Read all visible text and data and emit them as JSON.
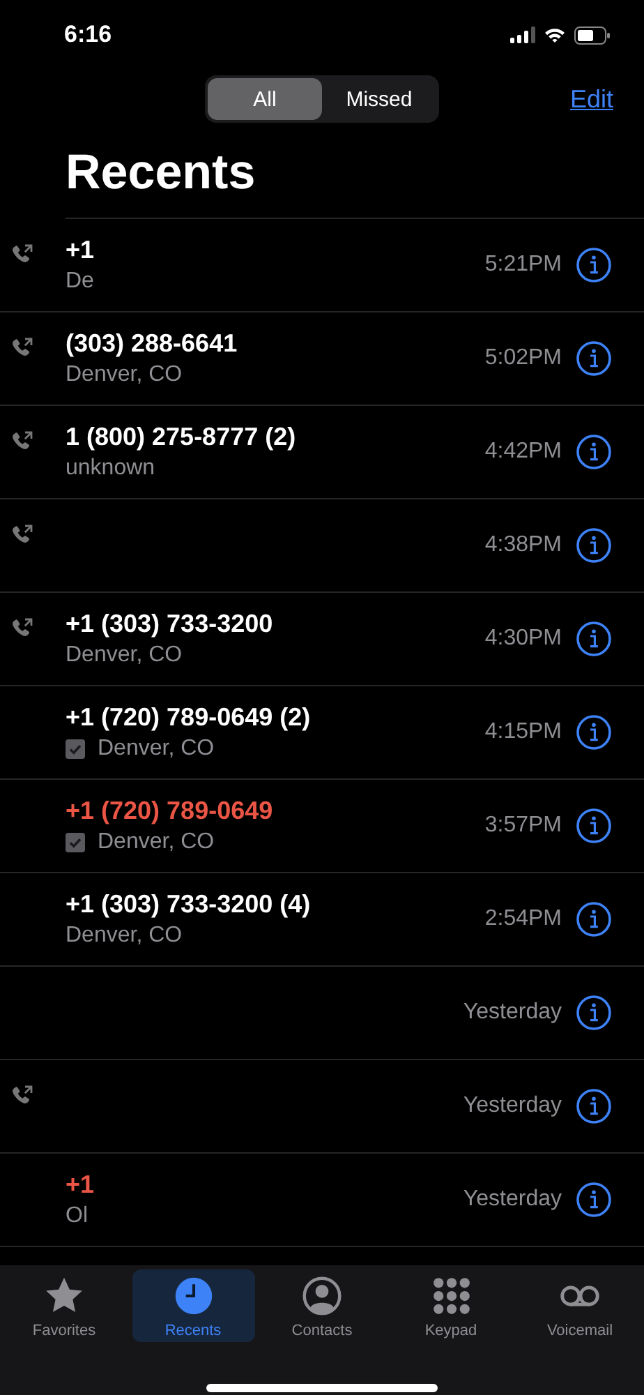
{
  "status_bar": {
    "time": "6:16"
  },
  "filter": {
    "segments": [
      {
        "label": "All",
        "selected": true
      },
      {
        "label": "Missed",
        "selected": false
      }
    ]
  },
  "edit_link": "Edit",
  "title": "Recents",
  "calls": [
    {
      "number": "+1",
      "detail": "De",
      "time": "5:21PM",
      "missed": false,
      "outgoing": true,
      "verified": false
    },
    {
      "number": "(303) 288-6641",
      "detail": "Denver, CO",
      "time": "5:02PM",
      "missed": false,
      "outgoing": true,
      "verified": false
    },
    {
      "number": "1 (800) 275-8777 (2)",
      "detail": "unknown",
      "time": "4:42PM",
      "missed": false,
      "outgoing": true,
      "verified": false
    },
    {
      "time": "4:38PM",
      "outgoing": true
    },
    {
      "number": "+1 (303) 733-3200",
      "detail": "Denver, CO",
      "time": "4:30PM",
      "missed": false,
      "outgoing": true,
      "verified": false
    },
    {
      "number": "+1 (720) 789-0649 (2)",
      "detail": "Denver, CO",
      "time": "4:15PM",
      "missed": false,
      "outgoing": false,
      "verified": true
    },
    {
      "number": "+1 (720) 789-0649",
      "detail": "Denver, CO",
      "time": "3:57PM",
      "missed": true,
      "outgoing": false,
      "verified": true
    },
    {
      "number": "+1 (303) 733-3200 (4)",
      "detail": "Denver, CO",
      "time": "2:54PM",
      "missed": false,
      "outgoing": false,
      "verified": false
    },
    {
      "time": "Yesterday",
      "outgoing": false
    },
    {
      "time": "Yesterday",
      "outgoing": true
    },
    {
      "number": "+1",
      "detail": "Ol",
      "time": "Yesterday",
      "missed": true,
      "outgoing": false,
      "verified": false
    }
  ],
  "tab_bar": [
    {
      "label": "Favorites",
      "kind": "star",
      "selected": false
    },
    {
      "label": "Recents",
      "kind": "clock",
      "selected": true
    },
    {
      "label": "Contacts",
      "kind": "person",
      "selected": false
    },
    {
      "label": "Keypad",
      "kind": "keypad",
      "selected": false
    },
    {
      "label": "Voicemail",
      "kind": "voicemail",
      "selected": false
    }
  ]
}
